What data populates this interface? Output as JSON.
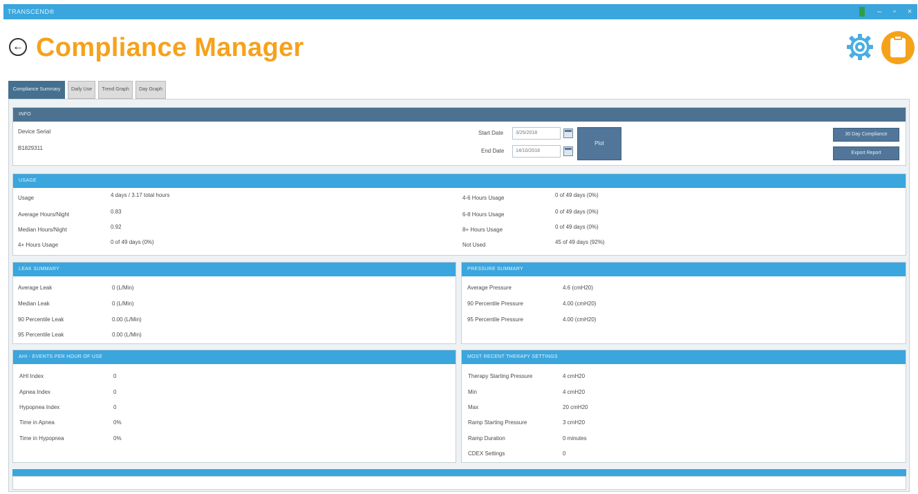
{
  "window": {
    "app_title": "TRANSCEND®",
    "minimize": "–",
    "restore": "▫",
    "close": "×"
  },
  "header": {
    "back_icon": "←",
    "title": "Compliance Manager"
  },
  "tabs": [
    {
      "label": "Compliance Summary",
      "active": true
    },
    {
      "label": "Daily Use",
      "active": false
    },
    {
      "label": "Trend Graph",
      "active": false
    },
    {
      "label": "Day Graph",
      "active": false
    }
  ],
  "info": {
    "header": "INFO",
    "device_serial_label": "Device Serial",
    "device_serial_value": "B1829311",
    "start_date_label": "Start Date",
    "start_date_value": "3/25/2018",
    "end_date_label": "End Date",
    "end_date_value": "14/10/2018",
    "plot_button": "Plot",
    "compliance_button": "30 Day Compliance",
    "export_button": "Export Report"
  },
  "usage": {
    "header": "USAGE",
    "left": [
      {
        "label": "Usage",
        "value": "4 days / 3.17 total hours"
      },
      {
        "label": "Average Hours/Night",
        "value": "0.83"
      },
      {
        "label": "Median Hours/Night",
        "value": "0.92"
      },
      {
        "label": "4+ Hours Usage",
        "value": "0 of 49 days (0%)"
      }
    ],
    "right": [
      {
        "label": "4-6 Hours Usage",
        "value": "0 of 49 days (0%)"
      },
      {
        "label": "6-8 Hours Usage",
        "value": "0 of 49 days (0%)"
      },
      {
        "label": "8+ Hours Usage",
        "value": "0 of 49 days (0%)"
      },
      {
        "label": "Not Used",
        "value": "45 of 49 days (92%)"
      }
    ]
  },
  "leak": {
    "header": "LEAK SUMMARY",
    "rows": [
      {
        "label": "Average Leak",
        "value": "0 (L/Min)"
      },
      {
        "label": "Median Leak",
        "value": "0 (L/Min)"
      },
      {
        "label": "90 Percentile Leak",
        "value": "0.00 (L/Min)"
      },
      {
        "label": "95 Percentile Leak",
        "value": "0.00 (L/Min)"
      }
    ]
  },
  "pressure": {
    "header": "PRESSURE SUMMARY",
    "rows": [
      {
        "label": "Average Pressure",
        "value": "4.6 (cmH20)"
      },
      {
        "label": "90 Percentile Pressure",
        "value": "4.00 (cmH20)"
      },
      {
        "label": "95 Percentile Pressure",
        "value": "4.00 (cmH20)"
      }
    ]
  },
  "ahi": {
    "header": "AHI - EVENTS PER HOUR OF USE",
    "rows": [
      {
        "label": "AHI Index",
        "value": "0"
      },
      {
        "label": "Apnea Index",
        "value": "0"
      },
      {
        "label": "Hypopnea Index",
        "value": "0"
      },
      {
        "label": "Time in Apnea",
        "value": "0%"
      },
      {
        "label": "Time in Hypopnea",
        "value": "0%"
      }
    ]
  },
  "therapy": {
    "header": "MOST RECENT THERAPY SETTINGS",
    "rows": [
      {
        "label": "Therapy Starting Pressure",
        "value": "4 cmH20"
      },
      {
        "label": "Min",
        "value": "4 cmH20"
      },
      {
        "label": "Max",
        "value": "20 cmH20"
      },
      {
        "label": "Ramp Starting Pressure",
        "value": "3 cmH20"
      },
      {
        "label": "Ramp Duration",
        "value": "0 minutes"
      },
      {
        "label": "CDEX Settings",
        "value": "0"
      }
    ]
  },
  "colors": {
    "accent_orange": "#f5a21b",
    "title_bar_blue": "#3aa6dd",
    "section_dark": "#4d7291"
  }
}
